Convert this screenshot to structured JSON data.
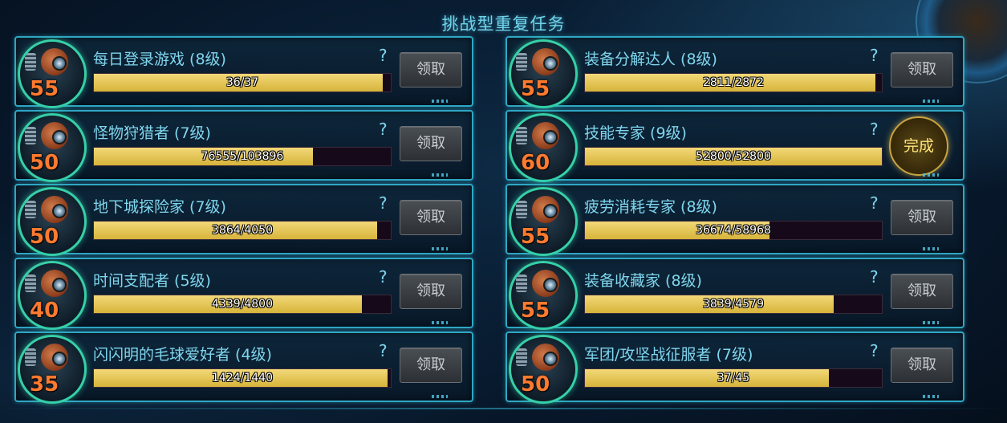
{
  "title": "挑战型重复任务",
  "colors": {
    "accent": "#2fa7c4",
    "progress": "#d6b43a",
    "level": "#ff7a2e",
    "done": "#c8a440"
  },
  "quests": [
    {
      "name": "每日登录游戏 (8级)",
      "level": "55",
      "current": 36,
      "total": 37,
      "progress_text": "36/37",
      "help": "?",
      "action": "领取",
      "action_type": "claim"
    },
    {
      "name": "装备分解达人 (8级)",
      "level": "55",
      "current": 2811,
      "total": 2872,
      "progress_text": "2811/2872",
      "help": "?",
      "action": "领取",
      "action_type": "claim"
    },
    {
      "name": "怪物狩猎者 (7级)",
      "level": "50",
      "current": 76555,
      "total": 103896,
      "progress_text": "76555/103896",
      "help": "?",
      "action": "领取",
      "action_type": "claim"
    },
    {
      "name": "技能专家 (9级)",
      "level": "60",
      "current": 52800,
      "total": 52800,
      "progress_text": "52800/52800",
      "help": "?",
      "action": "完成",
      "action_type": "done"
    },
    {
      "name": "地下城探险家 (7级)",
      "level": "50",
      "current": 3864,
      "total": 4050,
      "progress_text": "3864/4050",
      "help": "?",
      "action": "领取",
      "action_type": "claim"
    },
    {
      "name": "疲劳消耗专家 (8级)",
      "level": "55",
      "current": 36674,
      "total": 58968,
      "progress_text": "36674/58968",
      "help": "?",
      "action": "领取",
      "action_type": "claim"
    },
    {
      "name": "时间支配者 (5级)",
      "level": "40",
      "current": 4339,
      "total": 4800,
      "progress_text": "4339/4800",
      "help": "?",
      "action": "领取",
      "action_type": "claim"
    },
    {
      "name": "装备收藏家 (8级)",
      "level": "55",
      "current": 3839,
      "total": 4579,
      "progress_text": "3839/4579",
      "help": "?",
      "action": "领取",
      "action_type": "claim"
    },
    {
      "name": "闪闪明的毛球爱好者 (4级)",
      "level": "35",
      "current": 1424,
      "total": 1440,
      "progress_text": "1424/1440",
      "help": "?",
      "action": "领取",
      "action_type": "claim"
    },
    {
      "name": "军团/攻坚战征服者 (7级)",
      "level": "50",
      "current": 37,
      "total": 45,
      "progress_text": "37/45",
      "help": "?",
      "action": "领取",
      "action_type": "claim"
    }
  ]
}
